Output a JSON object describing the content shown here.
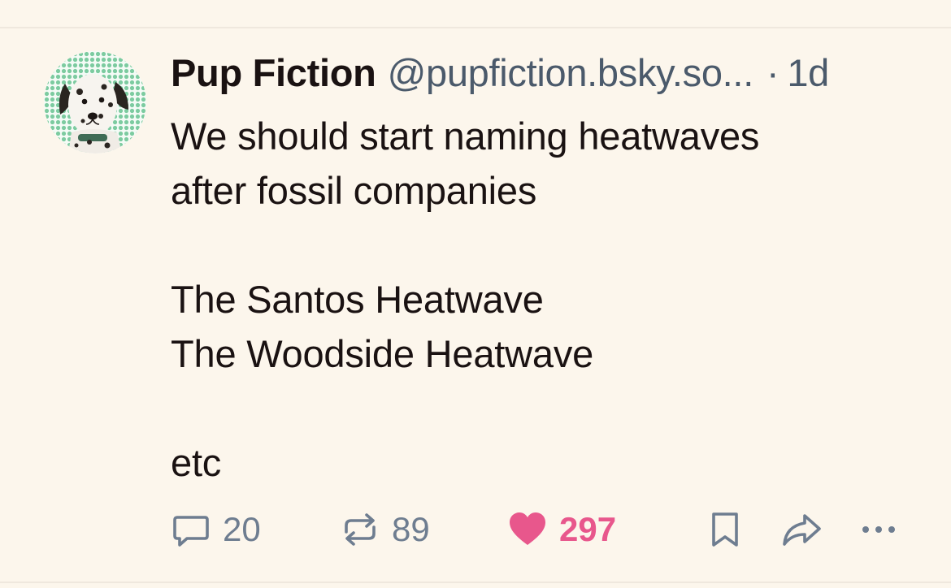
{
  "post": {
    "author_name": "Pup Fiction",
    "author_handle": "@pupfiction.bsky.so...",
    "separator": "·",
    "timestamp": "1d",
    "text_line_1": "We should start naming heatwaves\nafter fossil companies",
    "text_line_2": "The Santos Heatwave\nThe Woodside Heatwave",
    "text_line_3": "etc"
  },
  "actions": {
    "reply_count": "20",
    "repost_count": "89",
    "like_count": "297",
    "liked": true
  },
  "icons": {
    "reply": "speech-bubble-icon",
    "repost": "repost-arrows-icon",
    "like": "heart-icon",
    "bookmark": "bookmark-icon",
    "share": "share-arrow-icon",
    "more": "ellipsis-icon"
  },
  "colors": {
    "background": "#fcf6ec",
    "text": "#1a1212",
    "muted": "#4b5a6b",
    "action_icon": "#6e7d90",
    "like_active": "#e8578c",
    "avatar_dots": "#7ccba0"
  }
}
